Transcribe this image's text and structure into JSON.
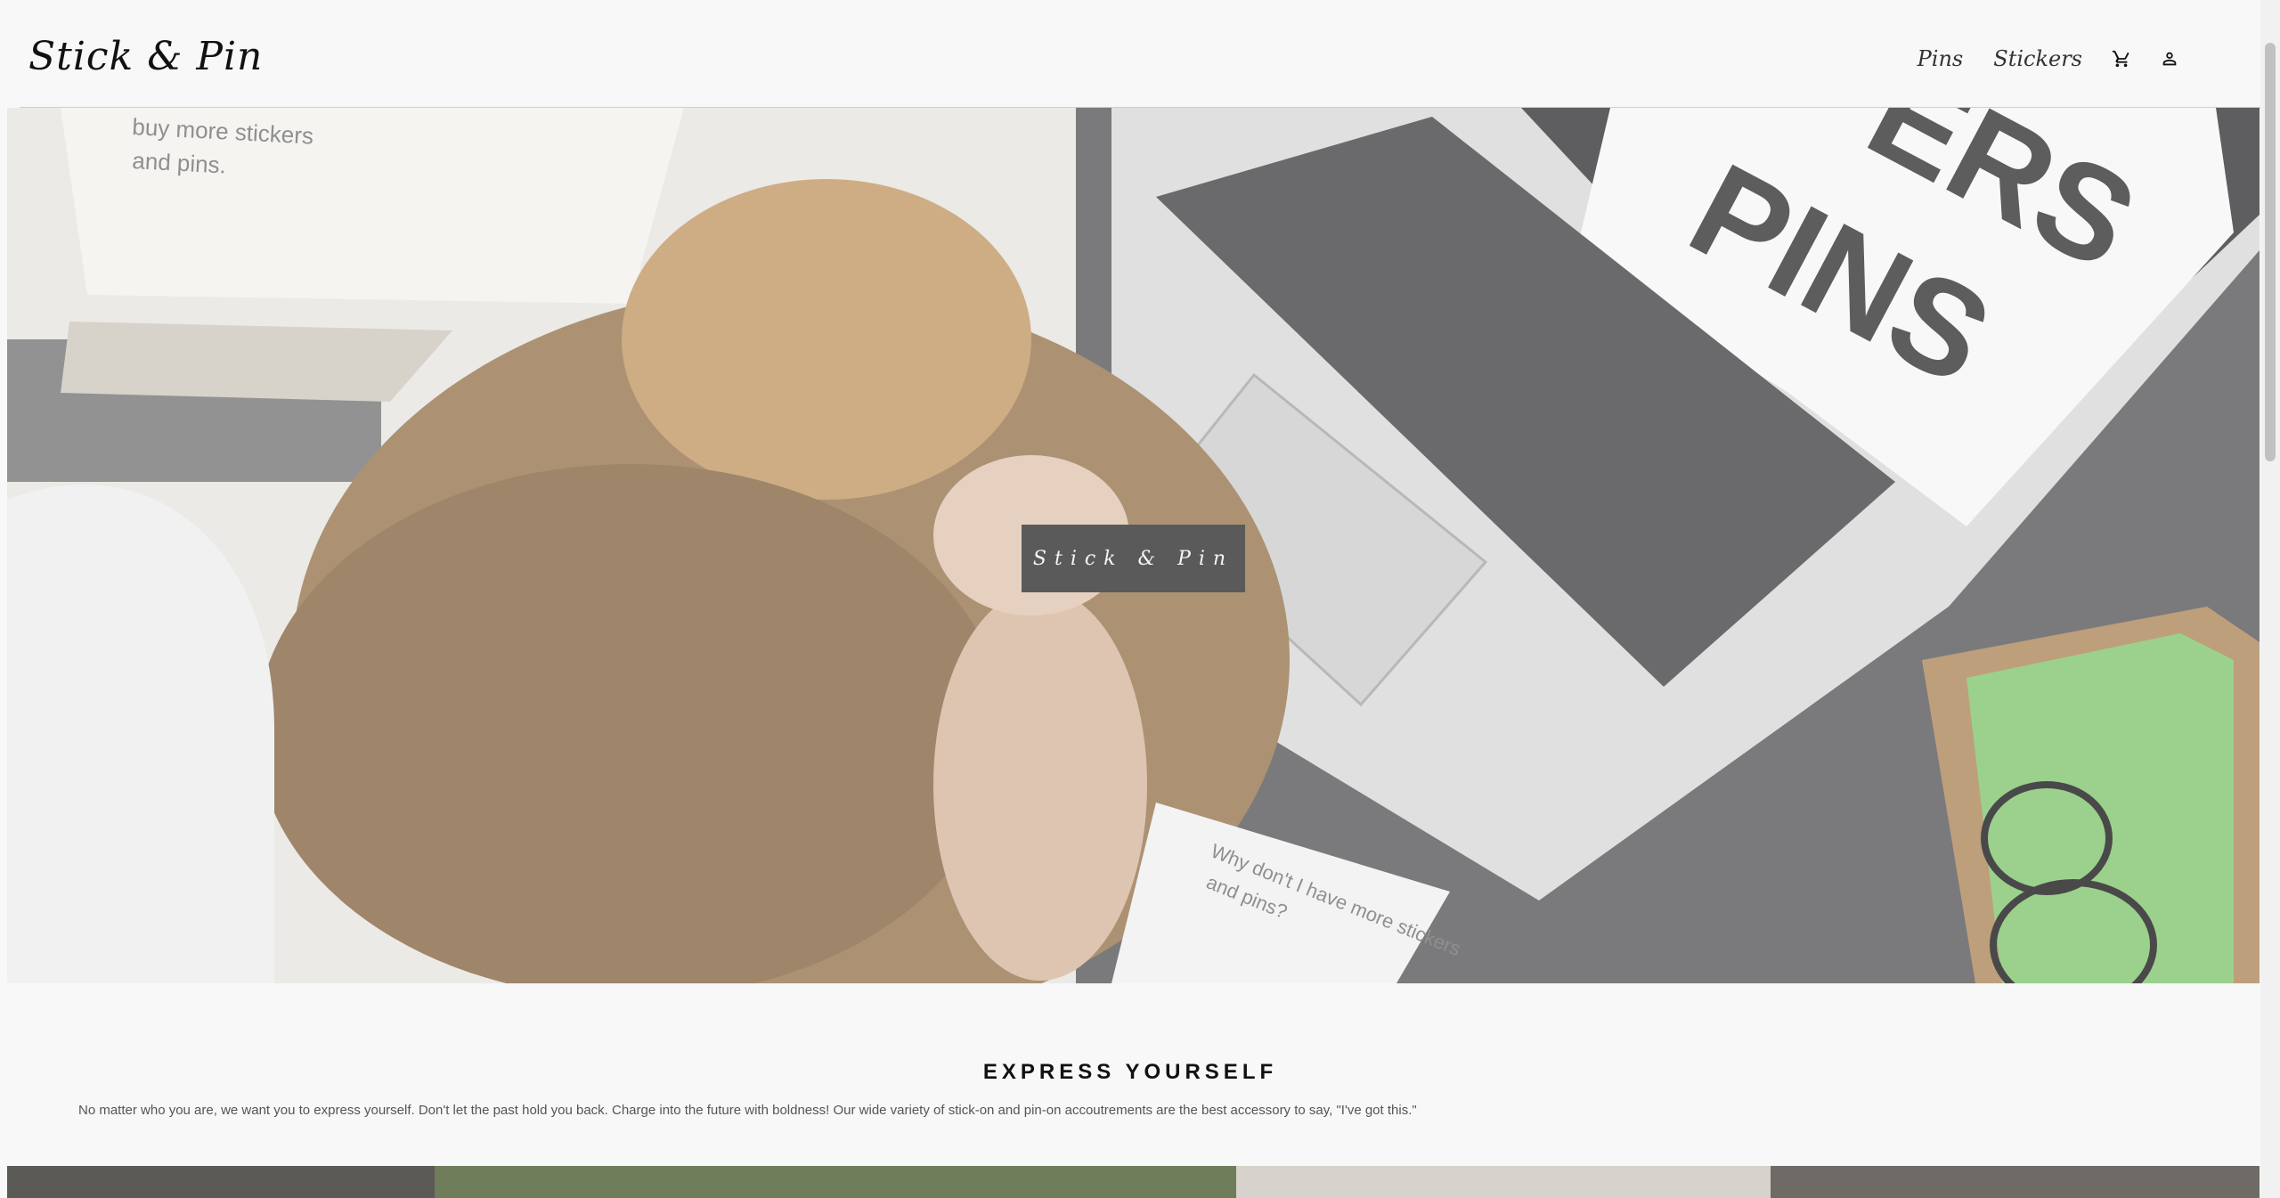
{
  "header": {
    "logo": "Stick & Pin",
    "nav": [
      {
        "label": "Pins"
      },
      {
        "label": "Stickers"
      }
    ],
    "icons": [
      "cart-icon",
      "account-icon"
    ]
  },
  "hero": {
    "badge_text": "Stick & Pin",
    "image_texts": {
      "notepad_top": "buy more stickers and pins.",
      "laptop_screen": "ERS PINS",
      "notepad_bottom": "Why don't I have more stickers and pins?"
    }
  },
  "section": {
    "title": "EXPRESS YOURSELF",
    "body": "No matter who you are, we want you to express yourself. Don't let the past hold you back. Charge into the future with boldness! Our wide variety of stick-on and pin-on accoutrements are the best accessory to say, \"I've got this.\""
  },
  "colors": {
    "background": "#f8f8f8",
    "badge": "#5a5a5a",
    "text": "#111111",
    "body_text": "#555555"
  }
}
